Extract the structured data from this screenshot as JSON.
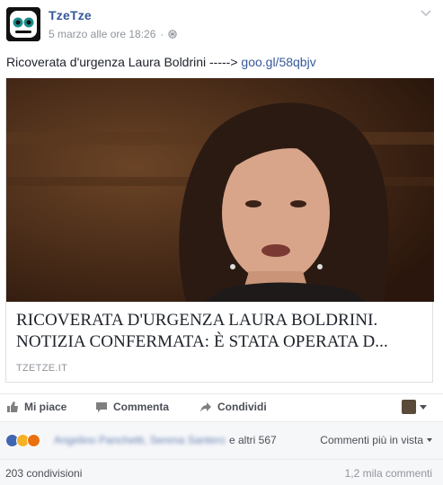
{
  "post": {
    "page_name": "TzeTze",
    "timestamp": "5 marzo alle ore 18:26",
    "separator": "·",
    "text_prefix": "Ricoverata d'urgenza Laura Boldrini ----->",
    "text_link": "goo.gl/58qbjv"
  },
  "preview": {
    "title": "RICOVERATA D'URGENZA LAURA BOLDRINI. NOTIZIA CONFERMATA: È STATA OPERATA D...",
    "domain": "TZETZE.IT"
  },
  "actions": {
    "like": "Mi piace",
    "comment": "Commenta",
    "share": "Condividi"
  },
  "reactions": {
    "names": "Angelino Panchetti, Serena Santero",
    "others": "e altri 567",
    "sort": "Commenti più in vista"
  },
  "stats": {
    "shares": "203 condivisioni",
    "comments": "1,2 mila commenti"
  },
  "colors": {
    "link": "#365899",
    "like_blue": "#4267b2",
    "haha_yellow": "#f7b125",
    "angry_orange": "#e9710f"
  }
}
